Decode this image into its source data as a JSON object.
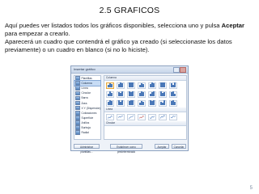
{
  "slide": {
    "title": "2.5 GRAFICOS",
    "paragraph1_part1": "Aquí puedes ver listados todos los gráficos disponibles, selecciona uno y pulsa ",
    "paragraph1_bold": "Aceptar",
    "paragraph1_part2": " para empezar a crearlo.",
    "paragraph2": "Aparecerá un cuadro que contendrá el gráfico ya creado (si seleccionaste los datos previamente) o un cuadro en blanco (si no lo hiciste).",
    "page_number": "5"
  },
  "dialog": {
    "title": "Insertar gráfico",
    "categories": [
      {
        "label": "Plantillas",
        "selected": false
      },
      {
        "label": "Columna",
        "selected": true
      },
      {
        "label": "Línea",
        "selected": false
      },
      {
        "label": "Circular",
        "selected": false
      },
      {
        "label": "Barra",
        "selected": false
      },
      {
        "label": "Área",
        "selected": false
      },
      {
        "label": "X Y (Dispersión)",
        "selected": false
      },
      {
        "label": "Cotizaciones",
        "selected": false
      },
      {
        "label": "Superficie",
        "selected": false
      },
      {
        "label": "Anillos",
        "selected": false
      },
      {
        "label": "Burbuja",
        "selected": false
      },
      {
        "label": "Radial",
        "selected": false
      }
    ],
    "section_column": "Columna",
    "section_line": "Línea",
    "section_circular": "Circular",
    "buttons": {
      "manage_templates": "Administrar plantillas...",
      "set_default": "Establecer como predeterminado",
      "ok": "Aceptar",
      "cancel": "Cancelar"
    }
  }
}
